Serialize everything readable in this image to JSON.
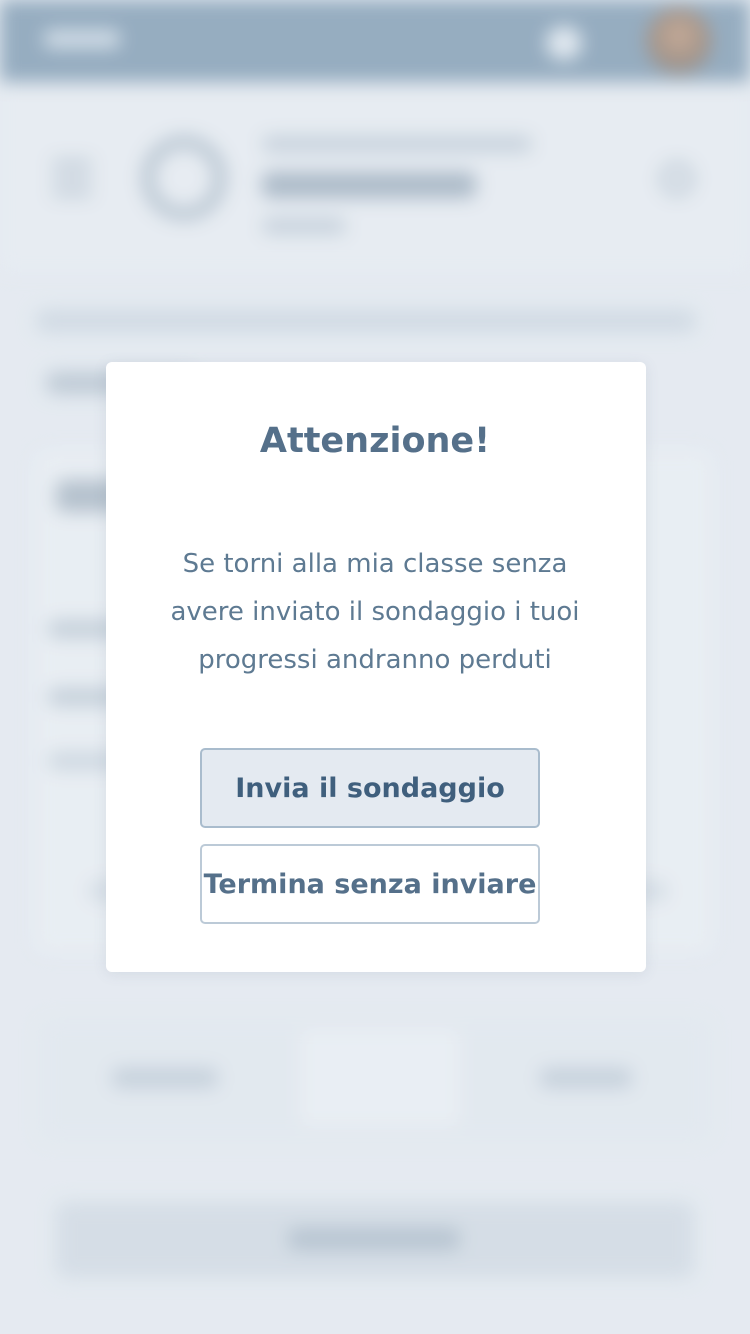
{
  "dialog": {
    "title": "Attenzione!",
    "message_lines": [
      "Se torni alla mia classe senza",
      "avere inviato il sondaggio i tuoi",
      "progressi andranno perduti"
    ],
    "primary_button": "Invia il sondaggio",
    "secondary_button": "Termina senza inviare"
  },
  "background": {
    "blurred": true,
    "top_bar_color": "#6a8aa5",
    "icons": [
      "menu-icon",
      "search-icon",
      "bell-icon",
      "avatar"
    ]
  },
  "colors": {
    "title": "#55708a",
    "text": "#5e7a92",
    "primary_button_bg": "#e4eaf1",
    "primary_button_border": "#a9bccd"
  }
}
